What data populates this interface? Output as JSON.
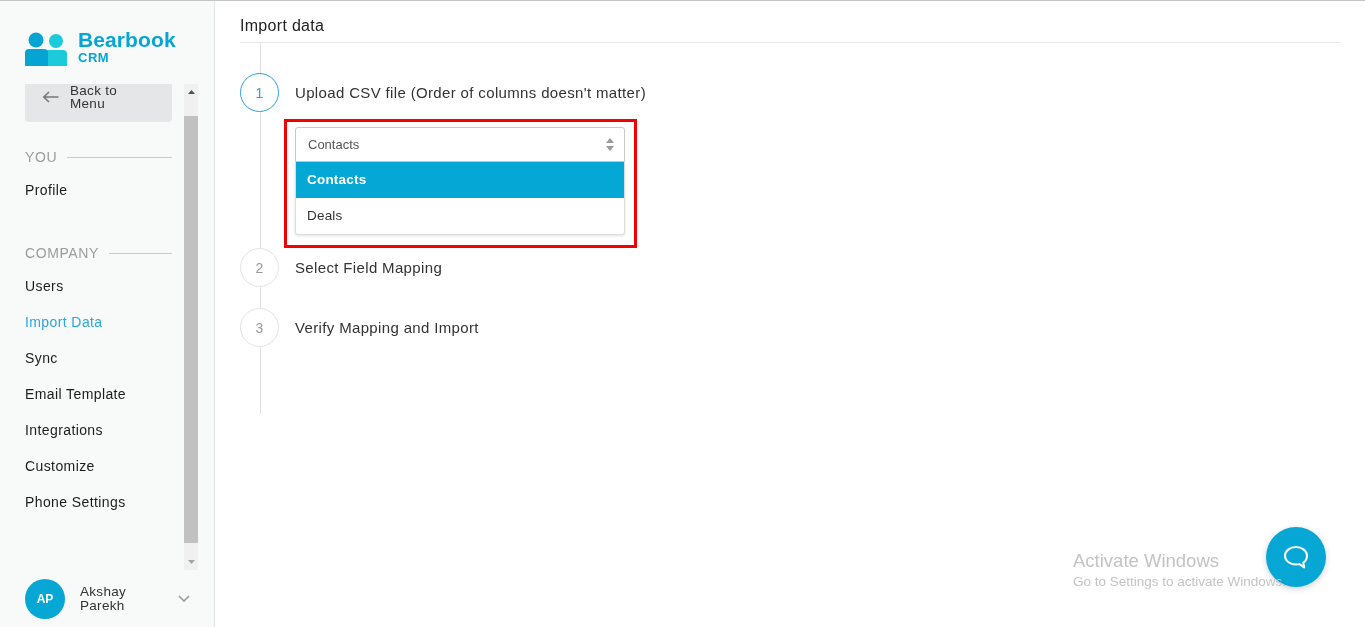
{
  "sidebar": {
    "logo": {
      "name": "Bearbook",
      "tagline": "CRM"
    },
    "back_button": {
      "label": "Back to Menu"
    },
    "sections": [
      {
        "heading": "YOU",
        "items": [
          {
            "label": "Profile",
            "selected": false
          }
        ]
      },
      {
        "heading": "COMPANY",
        "items": [
          {
            "label": "Users",
            "selected": false
          },
          {
            "label": "Import Data",
            "selected": true
          },
          {
            "label": "Sync",
            "selected": false
          },
          {
            "label": "Email Template",
            "selected": false
          },
          {
            "label": "Integrations",
            "selected": false
          },
          {
            "label": "Customize",
            "selected": false
          },
          {
            "label": "Phone Settings",
            "selected": false
          }
        ]
      }
    ],
    "user": {
      "initials": "AP",
      "name": "Akshay Parekh"
    }
  },
  "main": {
    "title": "Import data",
    "steps": [
      {
        "number": "1",
        "title": "Upload CSV file (Order of columns doesn't matter)",
        "active": true,
        "select": {
          "value": "Contacts",
          "expanded": true,
          "highlighted": true,
          "options": [
            {
              "label": "Contacts",
              "selected": true
            },
            {
              "label": "Deals",
              "selected": false
            }
          ]
        }
      },
      {
        "number": "2",
        "title": "Select Field Mapping",
        "active": false
      },
      {
        "number": "3",
        "title": "Verify Mapping and Import",
        "active": false
      }
    ]
  },
  "os_notice": {
    "title": "Activate Windows",
    "text": "Go to Settings to activate Windows."
  }
}
